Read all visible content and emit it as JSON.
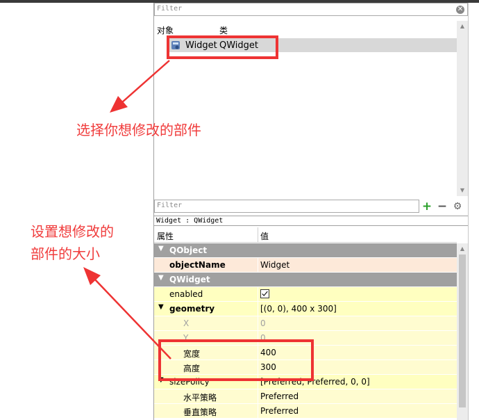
{
  "object_inspector": {
    "filter_placeholder": "Filter",
    "columns": {
      "object": "对象",
      "class": "类"
    },
    "items": [
      {
        "name": "Widget",
        "class": "QWidget"
      }
    ]
  },
  "property_editor": {
    "filter_placeholder": "Filter",
    "add_label": "+",
    "remove_label": "−",
    "configure_label": "⚙",
    "title": "Widget : QWidget",
    "columns": {
      "property": "属性",
      "value": "值"
    },
    "groups": [
      {
        "name": "QObject"
      },
      {
        "name": "QWidget"
      }
    ],
    "properties": {
      "objectName": {
        "key": "objectName",
        "value": "Widget"
      },
      "enabled": {
        "key": "enabled",
        "checked": true
      },
      "geometry": {
        "key": "geometry",
        "value": "[(0, 0), 400 x 300]"
      },
      "x": {
        "key": "X",
        "value": "0"
      },
      "y": {
        "key": "Y",
        "value": "0"
      },
      "width": {
        "key": "宽度",
        "value": "400"
      },
      "height": {
        "key": "高度",
        "value": "300"
      },
      "sizePolicy": {
        "key": "sizePolicy",
        "value": "[Preferred, Preferred, 0, 0]"
      },
      "h_policy": {
        "key": "水平策略",
        "value": "Preferred"
      },
      "v_policy": {
        "key": "垂直策略",
        "value": "Preferred"
      }
    }
  },
  "annotations": {
    "select_widget": "选择你想修改的部件",
    "set_size_line1": "设置想修改的",
    "set_size_line2": "部件的大小",
    "color": "#ee3333"
  }
}
